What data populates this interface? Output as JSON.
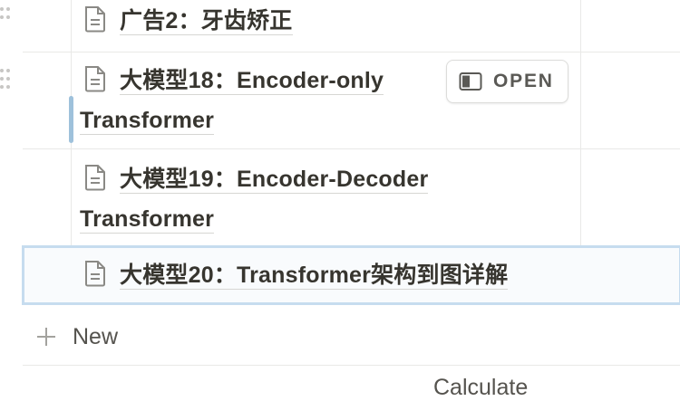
{
  "table": {
    "rows": [
      {
        "title": "广告2：牙齿矫正"
      },
      {
        "title_line1": "大模型18：Encoder-only",
        "title_line2": "Transformer"
      },
      {
        "title_line1": "大模型19：Encoder-Decoder",
        "title_line2": "Transformer"
      },
      {
        "title": "大模型20：Transformer架构到图详解"
      }
    ],
    "open_button_label": "OPEN",
    "new_label": "New",
    "calculate_label": "Calculate"
  },
  "icons": {
    "page": "page-icon",
    "drag": "drag-handle-icon",
    "open": "open-panel-icon",
    "plus": "plus-icon"
  },
  "colors": {
    "selection_border": "#c6dcef",
    "resize_handle": "#9ec1db",
    "text": "#37352f"
  }
}
